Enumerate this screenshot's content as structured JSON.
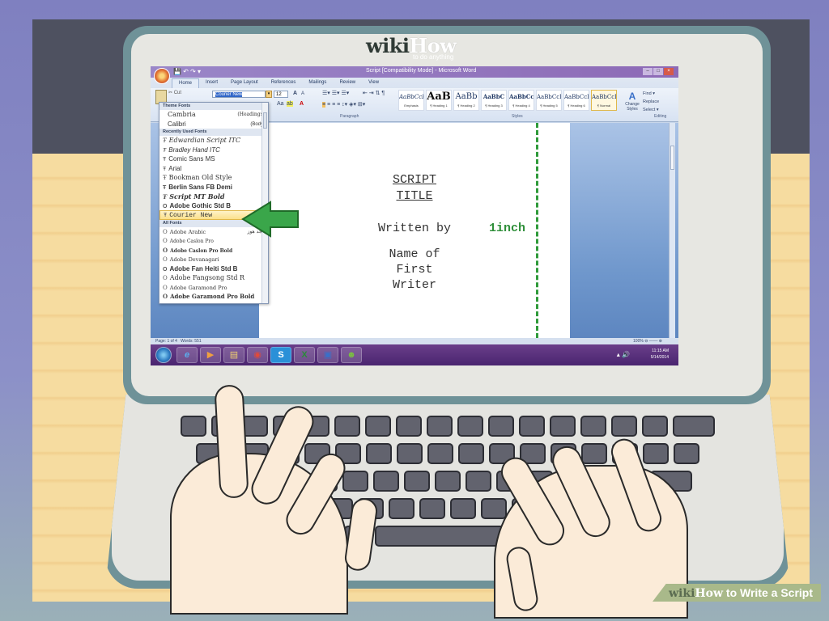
{
  "branding": {
    "wiki": "wiki",
    "how": "How",
    "tagline": "to do anything",
    "footer_title": " to Write a Script"
  },
  "window": {
    "title": "Script [Compatibility Mode] - Microsoft Word",
    "controls": [
      "–",
      "□",
      "×"
    ]
  },
  "ribbon": {
    "tabs": [
      {
        "label": "Home",
        "active": true
      },
      {
        "label": "Insert"
      },
      {
        "label": "Page Layout"
      },
      {
        "label": "References"
      },
      {
        "label": "Mailings"
      },
      {
        "label": "Review"
      },
      {
        "label": "View"
      }
    ],
    "clipboard": {
      "cut_label": "✂ Cut"
    },
    "font": {
      "name_value": "Courier New",
      "size_value": "12",
      "grow": "A",
      "shrink": "A",
      "change_case": "Aa",
      "font_color": "A"
    },
    "paragraph_label": "Paragraph",
    "styles_label": "Styles",
    "editing_label": "Editing",
    "styles": [
      {
        "preview": "AaBbCcL",
        "name": "Emphasis",
        "size": "small"
      },
      {
        "preview": "AaB",
        "name": "¶ Heading 1",
        "size": "big"
      },
      {
        "preview": "AaBb",
        "name": "¶ Heading 2",
        "size": "med"
      },
      {
        "preview": "AaBbC",
        "name": "¶ Heading 3",
        "size": "small"
      },
      {
        "preview": "AaBbCc",
        "name": "¶ Heading 4",
        "size": "small"
      },
      {
        "preview": "AaBbCcI",
        "name": "¶ Heading 5",
        "size": "small"
      },
      {
        "preview": "AaBbCcDd",
        "name": "¶ Heading 6",
        "size": "small"
      },
      {
        "preview": "AaBbCcI",
        "name": "¶ Normal",
        "size": "small",
        "selected": true
      }
    ],
    "change_styles": "Change Styles",
    "find": "Find ▾",
    "replace": "Replace",
    "select": "Select ▾"
  },
  "font_dropdown": {
    "theme_header": "Theme Fonts",
    "theme_fonts": [
      {
        "name": "Cambria",
        "note": "(Headings)"
      },
      {
        "name": "Calibri",
        "note": "(Body)"
      }
    ],
    "recent_header": "Recently Used Fonts",
    "recent_fonts": [
      "Edwardian Script ITC",
      "Bradley Hand ITC",
      "Comic Sans MS",
      "Arial",
      "Bookman Old Style",
      "Berlin Sans FB Demi",
      "Script MT Bold",
      "Adobe Gothic Std B",
      "Courier New"
    ],
    "highlighted": "Courier New",
    "all_header": "All Fonts",
    "all_fonts": [
      {
        "name": "Adobe Arabic",
        "note": "أبجد هوز"
      },
      {
        "name": "Adobe Caslon Pro",
        "note": ""
      },
      {
        "name": "Adobe Caslon Pro Bold",
        "note": ""
      },
      {
        "name": "Adobe Devanagari",
        "note": ""
      },
      {
        "name": "Adobe Fan Heiti Std B",
        "note": ""
      },
      {
        "name": "Adobe Fangsong Std R",
        "note": ""
      },
      {
        "name": "Adobe Garamond Pro",
        "note": ""
      },
      {
        "name": "Adobe Garamond Pro Bold",
        "note": ""
      }
    ]
  },
  "document": {
    "title_line1": "SCRIPT",
    "title_line2": "TITLE",
    "written_by": "Written by",
    "author_line1": "Name of",
    "author_line2": "First",
    "author_line3": "Writer",
    "margin_annotation": "1inch",
    "margin_color": "#2f9a3a"
  },
  "statusbar": {
    "page": "Page: 1 of 4",
    "words": "Words: 551",
    "zoom": "100%"
  },
  "taskbar": {
    "apps": [
      {
        "name": "internet-explorer",
        "glyph": "e"
      },
      {
        "name": "media-player",
        "glyph": "▶"
      },
      {
        "name": "file-explorer",
        "glyph": "▤"
      },
      {
        "name": "chrome",
        "glyph": "◉"
      },
      {
        "name": "skype",
        "glyph": "S"
      },
      {
        "name": "excel",
        "glyph": "X"
      },
      {
        "name": "word-window",
        "glyph": "▣"
      },
      {
        "name": "messenger",
        "glyph": "☻"
      }
    ],
    "time": "11:15 AM",
    "date": "5/14/2014"
  }
}
